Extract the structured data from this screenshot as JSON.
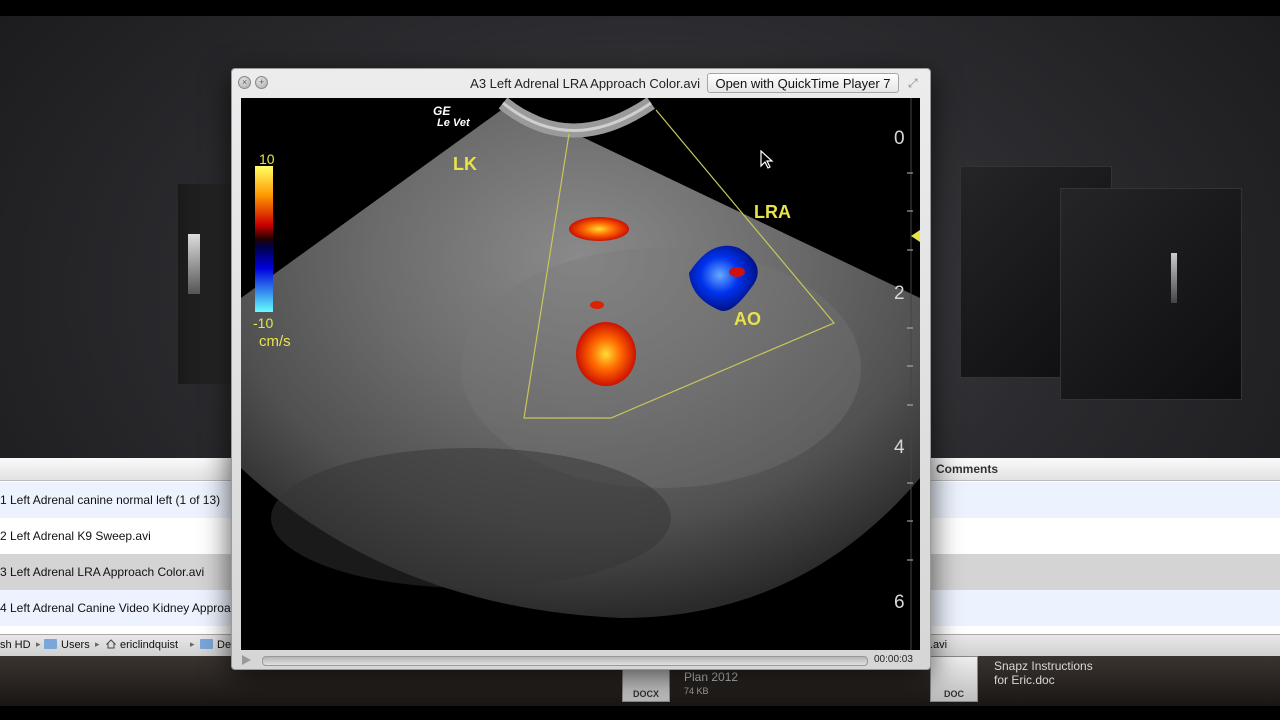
{
  "quicklook": {
    "title": "A3 Left Adrenal LRA Approach Color.avi",
    "open_with_label": "Open with QuickTime Player 7",
    "close_icon": "×",
    "fullscreen_icon": "⤢",
    "time": "00:00:03",
    "progress": 0.0
  },
  "ultrasound": {
    "brand_top": "GE",
    "brand_bottom": "Le Vet",
    "scale_max": "10",
    "scale_min": "-10",
    "scale_unit": "cm/s",
    "label_lk": "LK",
    "label_lra": "LRA",
    "label_ao": "AO",
    "depth_marks": [
      "0",
      "2",
      "4",
      "6"
    ]
  },
  "finder": {
    "column_comments": "Comments",
    "rows": [
      "1 Left Adrenal canine normal left (1 of 13)",
      "2 Left Adrenal K9 Sweep.avi",
      "3 Left Adrenal LRA Approach Color.avi",
      "4 Left Adrenal Canine Video Kidney Approa"
    ],
    "path": {
      "disk": "sh HD",
      "users": "Users",
      "home": "ericlindquist",
      "next": "De",
      "tail": ".avi"
    }
  },
  "desktop_docs": {
    "doc1_type": "DOCX",
    "doc1_name": "Plan 2012",
    "doc1_size": "74 KB",
    "doc2_type": "DOC",
    "doc2_name": "Snapz Instructions\nfor Eric.doc"
  },
  "colors": {
    "label_yellow": "#e9e34a",
    "sector_line": "#c9c65a"
  }
}
